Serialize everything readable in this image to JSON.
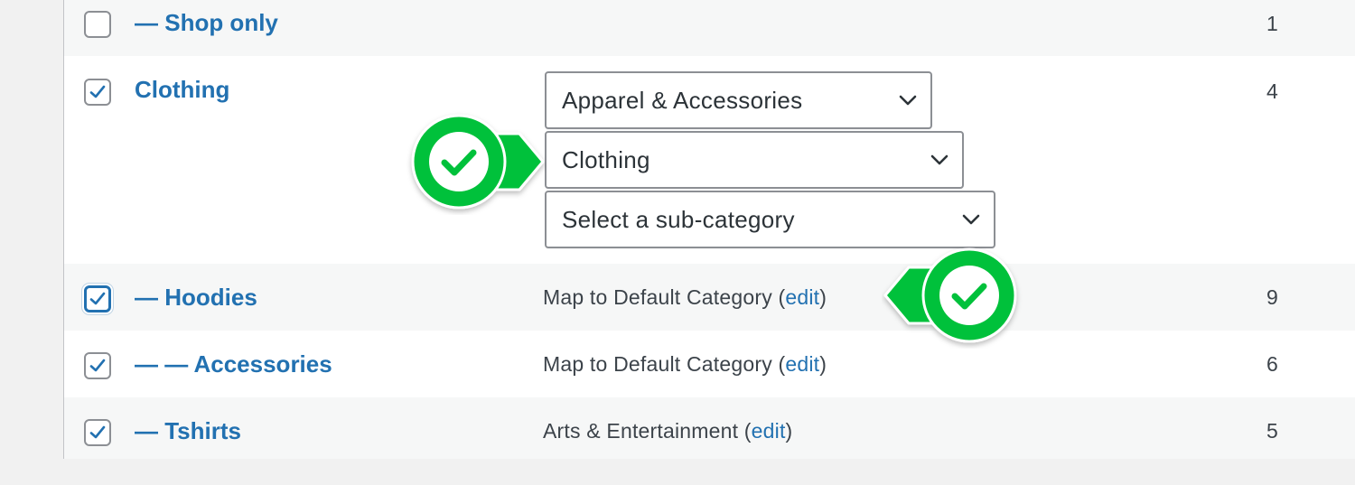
{
  "rows": [
    {
      "name": "— Shop only",
      "count": "1",
      "checked": false
    },
    {
      "name": "Clothing",
      "count": "4",
      "checked": true,
      "selects": [
        {
          "value": "Apparel & Accessories"
        },
        {
          "value": "Clothing"
        },
        {
          "value": "Select a sub-category"
        }
      ]
    },
    {
      "name": "— Hoodies",
      "count": "9",
      "checked": true,
      "mapping": "Map to Default Category",
      "edit": "edit"
    },
    {
      "name": "— — Accessories",
      "count": "6",
      "checked": true,
      "mapping": "Map to Default Category",
      "edit": "edit"
    },
    {
      "name": "— Tshirts",
      "count": "5",
      "checked": true,
      "mapping": "Arts & Entertainment",
      "edit": "edit"
    }
  ],
  "colors": {
    "link": "#2271b1",
    "badge_green": "#00c13a",
    "text": "#3c434a"
  },
  "icons": [
    "checkbox-checked-icon",
    "chevron-down-icon",
    "green-checkmark-badge-icon"
  ]
}
